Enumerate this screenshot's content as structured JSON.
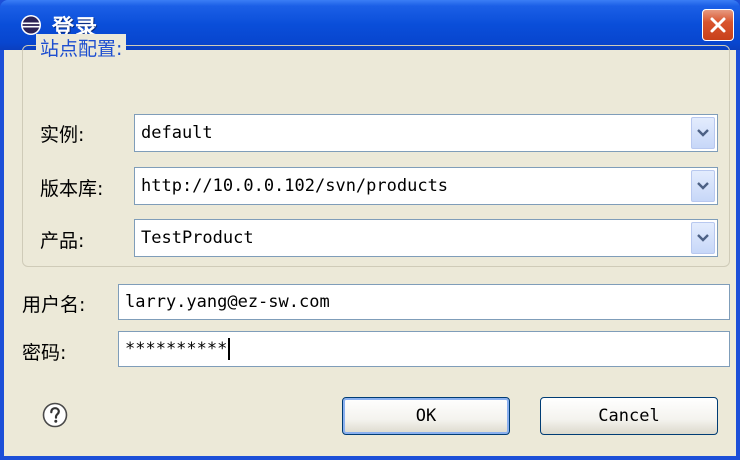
{
  "window": {
    "title": "登录"
  },
  "site_config": {
    "legend": "站点配置:",
    "instance": {
      "label": "实例:",
      "value": "default"
    },
    "repository": {
      "label": "版本库:",
      "value": "http://10.0.0.102/svn/products"
    },
    "product": {
      "label": "产品:",
      "value": "TestProduct"
    }
  },
  "credentials": {
    "username": {
      "label": "用户名:",
      "value": "larry.yang@ez-sw.com"
    },
    "password": {
      "label": "密码:",
      "value": "**********"
    }
  },
  "buttons": {
    "ok": "OK",
    "cancel": "Cancel"
  },
  "icons": {
    "app": "eclipse-icon",
    "close": "close-icon",
    "help": "help-icon",
    "dropdown": "chevron-down-icon"
  },
  "colors": {
    "title_bar": "#0a4ed9",
    "close_button": "#d9552e",
    "legend_text": "#1d4ed0",
    "dialog_background": "#ece9d8"
  }
}
